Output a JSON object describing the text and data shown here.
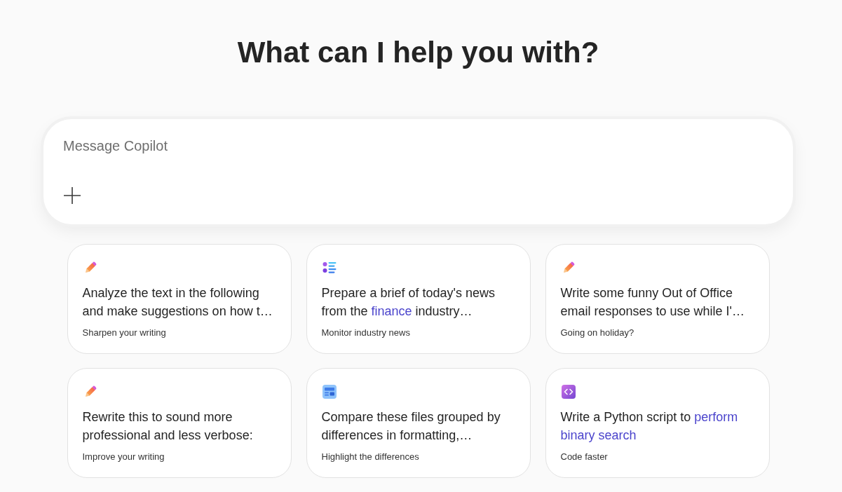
{
  "heading": "What can I help you with?",
  "composer": {
    "placeholder": "Message Copilot"
  },
  "suggestions": [
    {
      "kind": "writing",
      "prompt_lines": [
        [
          {
            "text": "Analyze the text in the following",
            "highlighted": false
          }
        ],
        [
          {
            "text": "and make suggestions on how t…",
            "highlighted": false
          }
        ]
      ],
      "caption": "Sharpen your writing"
    },
    {
      "kind": "news",
      "prompt_lines": [
        [
          {
            "text": "Prepare a brief of today's news",
            "highlighted": false
          }
        ],
        [
          {
            "text": "from the ",
            "highlighted": false
          },
          {
            "text": "finance",
            "highlighted": true
          },
          {
            "text": " industry…",
            "highlighted": false
          }
        ]
      ],
      "caption": "Monitor industry news"
    },
    {
      "kind": "writing",
      "prompt_lines": [
        [
          {
            "text": "Write some funny Out of Office",
            "highlighted": false
          }
        ],
        [
          {
            "text": "email responses to use while I'…",
            "highlighted": false
          }
        ]
      ],
      "caption": "Going on holiday?"
    },
    {
      "kind": "writing",
      "prompt_lines": [
        [
          {
            "text": "Rewrite this to sound more",
            "highlighted": false
          }
        ],
        [
          {
            "text": "professional and less verbose:",
            "highlighted": false
          }
        ]
      ],
      "caption": "Improve your writing"
    },
    {
      "kind": "compare",
      "prompt_lines": [
        [
          {
            "text": "Compare these files grouped by",
            "highlighted": false
          }
        ],
        [
          {
            "text": "differences in formatting,…",
            "highlighted": false
          }
        ]
      ],
      "caption": "Highlight the differences"
    },
    {
      "kind": "code",
      "prompt_lines": [
        [
          {
            "text": "Write a Python script to ",
            "highlighted": false
          },
          {
            "text": "perform",
            "highlighted": true
          }
        ],
        [
          {
            "text": "binary search",
            "highlighted": true
          }
        ]
      ],
      "caption": "Code faster"
    }
  ]
}
